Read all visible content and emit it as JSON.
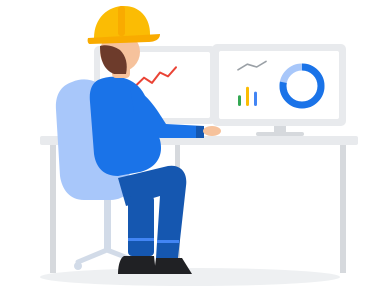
{
  "colors": {
    "background": "#ffffff",
    "floor_shadow": "#eef0f2",
    "monitor_frame": "#e8eaed",
    "monitor_screen": "#ffffff",
    "desk_top": "#e8eaed",
    "desk_legs": "#d6d9dd",
    "chair": "#a8c7fa",
    "chair_base": "#d2dbe8",
    "shirt": "#1a73e8",
    "pants": "#1557b0",
    "skin": "#f6c29c",
    "hair": "#6d3b2b",
    "helmet": "#fbbc04",
    "shoes": "#202124",
    "chart_red": "#ea4335",
    "chart_gray": "#9aa0a6",
    "chart_green": "#34a853",
    "chart_yellow": "#fbbc04",
    "chart_blue": "#4285f4",
    "donut_blue": "#1a73e8",
    "donut_light": "#a8c7fa"
  },
  "icons": {
    "worker": "construction-worker-illustration",
    "helmet": "hard-hat-icon",
    "left_chart": "trend-line-chart-icon",
    "right_chart_bars": "bar-chart-icon",
    "right_chart_donut": "donut-chart-icon"
  },
  "left_monitor": {
    "trend_line_values": [
      0.25,
      0.55,
      0.35,
      0.75,
      0.6,
      0.95
    ]
  },
  "right_monitor": {
    "mini_trend_values": [
      0.3,
      0.7,
      0.5,
      0.9
    ],
    "bars": [
      0.45,
      0.8,
      0.6
    ],
    "donut_fraction": 0.78
  }
}
